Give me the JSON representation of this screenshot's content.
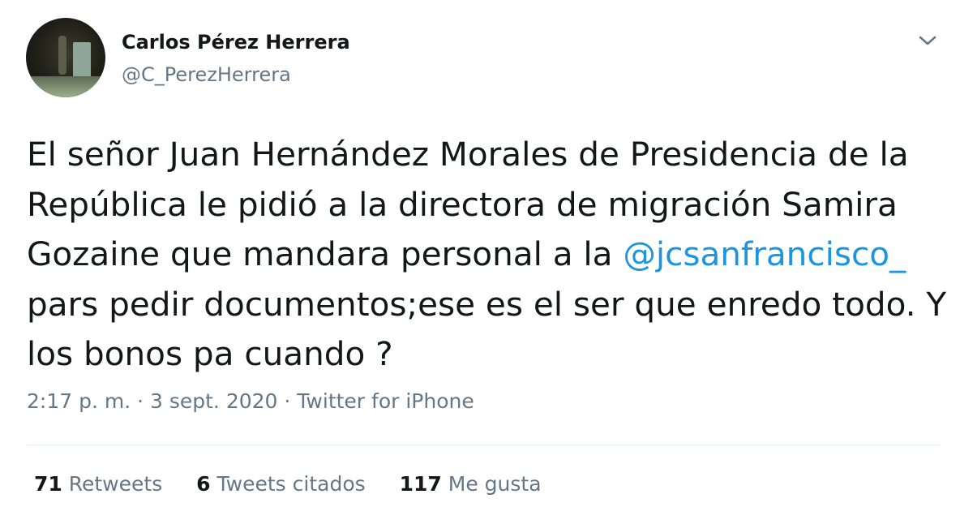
{
  "author": {
    "name": "Carlos Pérez Herrera",
    "handle": "@C_PerezHerrera"
  },
  "tweet": {
    "text_part1": "El señor Juan Hernández Morales de Presidencia de la República le pidió a la directora de migración Samira Gozaine que mandara personal a la ",
    "mention": "@jcsanfrancisco_",
    "text_part2": " pars pedir documentos;ese es el ser que enredo todo. Y los bonos pa cuando ?"
  },
  "meta": {
    "time": "2:17 p. m.",
    "separator1": " · ",
    "date": "3 sept. 2020",
    "separator2": " · ",
    "source": "Twitter for iPhone"
  },
  "stats": {
    "retweets_count": "71",
    "retweets_label": "Retweets",
    "quotes_count": "6",
    "quotes_label": "Tweets citados",
    "likes_count": "117",
    "likes_label": "Me gusta"
  },
  "colors": {
    "link": "#1b95e0",
    "secondary_text": "#657786",
    "primary_text": "#14171a",
    "divider": "#e6ecf0"
  },
  "icons": {
    "avatar": "user-avatar",
    "menu": "chevron-down-icon"
  }
}
